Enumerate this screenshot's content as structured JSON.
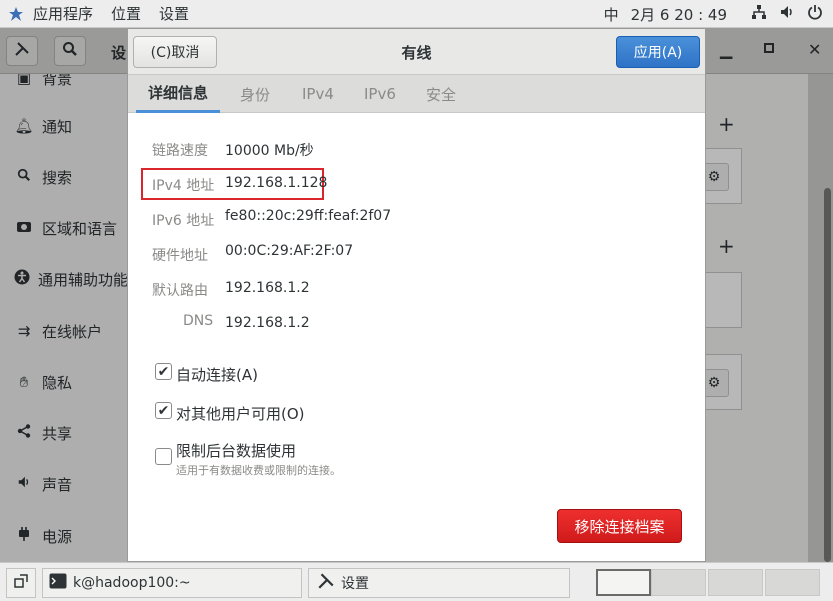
{
  "topbar": {
    "applications": "应用程序",
    "places": "位置",
    "settings": "设置",
    "input_method": "中",
    "datetime": "2月 6 20 : 49"
  },
  "settings_window": {
    "title_partial": "设",
    "sidebar": [
      {
        "label": "背景",
        "icon": "image-icon"
      },
      {
        "label": "通知",
        "icon": "bell-icon"
      },
      {
        "label": "搜索",
        "icon": "search-icon"
      },
      {
        "label": "区域和语言",
        "icon": "camera-icon"
      },
      {
        "label": "通用辅助功能",
        "icon": "accessibility-icon"
      },
      {
        "label": "在线帐户",
        "icon": "online-accounts-icon"
      },
      {
        "label": "隐私",
        "icon": "hand-icon"
      },
      {
        "label": "共享",
        "icon": "share-icon"
      },
      {
        "label": "声音",
        "icon": "speaker-icon"
      },
      {
        "label": "电源",
        "icon": "power-plug-icon"
      }
    ]
  },
  "dialog": {
    "cancel_label": "(C)取消",
    "title": "有线",
    "apply_label": "应用(A)",
    "tabs": [
      "详细信息",
      "身份",
      "IPv4",
      "IPv6",
      "安全"
    ],
    "active_tab": "详细信息",
    "details": [
      {
        "label": "链路速度",
        "value": "10000 Mb/秒"
      },
      {
        "label": "IPv4 地址",
        "value": "192.168.1.128"
      },
      {
        "label": "IPv6 地址",
        "value": "fe80::20c:29ff:feaf:2f07"
      },
      {
        "label": "硬件地址",
        "value": "00:0C:29:AF:2F:07"
      },
      {
        "label": "默认路由",
        "value": "192.168.1.2"
      },
      {
        "label": "DNS",
        "value": "192.168.1.2"
      }
    ],
    "checkboxes": [
      {
        "label": "自动连接(A)",
        "checked": true
      },
      {
        "label": "对其他用户可用(O)",
        "checked": true
      },
      {
        "label": "限制后台数据使用",
        "checked": false,
        "sublabel": "适用于有数据收费或限制的连接。"
      }
    ],
    "remove_label": "移除连接档案"
  },
  "taskbar": {
    "terminal_label": "k@hadoop100:~",
    "settings_label": "设置"
  },
  "colors": {
    "accent_blue": "#2f73c7",
    "destructive_red": "#d01a1a",
    "highlight_box": "#d9262d"
  }
}
